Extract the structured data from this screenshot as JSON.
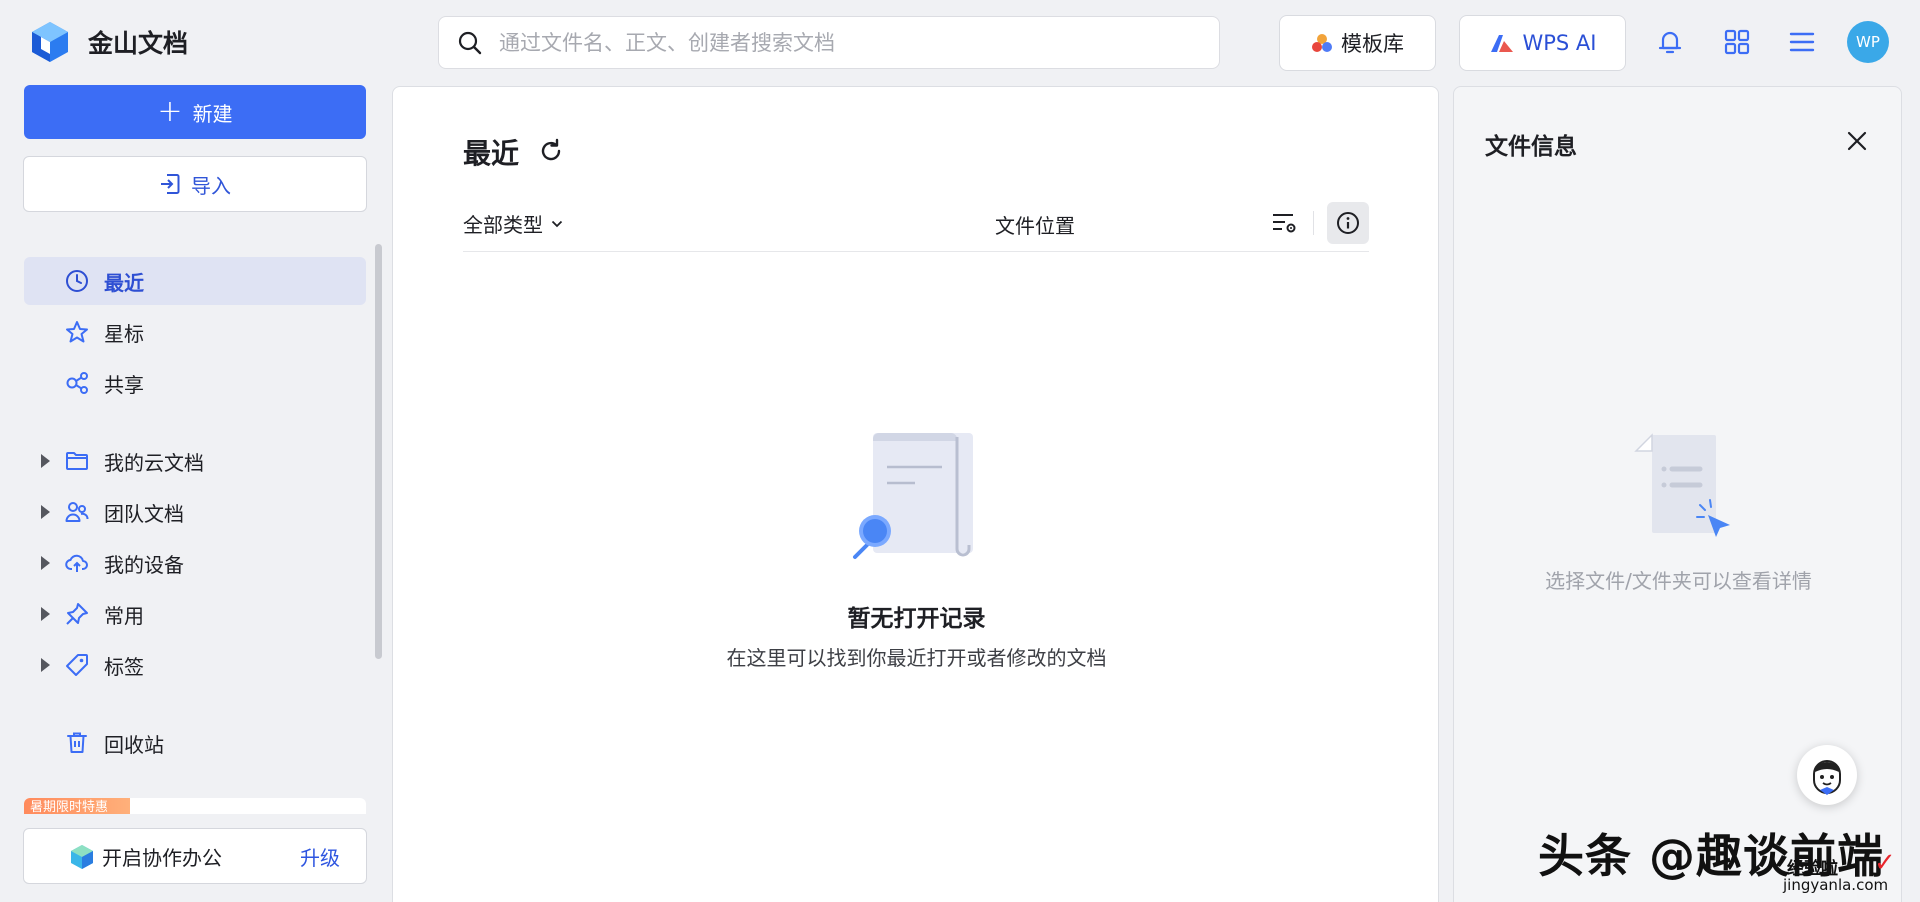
{
  "app": {
    "name": "金山文档"
  },
  "search": {
    "placeholder": "通过文件名、正文、创建者搜索文档"
  },
  "header": {
    "template_label": "模板库",
    "ai_label": "WPS AI",
    "avatar_text": "WP"
  },
  "sidebar": {
    "new_label": "新建",
    "import_label": "导入",
    "items": [
      {
        "label": "最近",
        "icon": "clock-icon",
        "active": true
      },
      {
        "label": "星标",
        "icon": "star-icon"
      },
      {
        "label": "共享",
        "icon": "share-icon"
      }
    ],
    "tree": [
      {
        "label": "我的云文档",
        "icon": "folder-icon"
      },
      {
        "label": "团队文档",
        "icon": "team-icon"
      },
      {
        "label": "我的设备",
        "icon": "cloud-upload-icon"
      },
      {
        "label": "常用",
        "icon": "pin-icon"
      },
      {
        "label": "标签",
        "icon": "tag-icon"
      }
    ],
    "trash_label": "回收站",
    "promo_badge": "暑期限时特惠",
    "collab_label": "开启协作办公",
    "upgrade_label": "升级"
  },
  "main": {
    "title": "最近",
    "filter_label": "全部类型",
    "location_header": "文件位置",
    "empty_title": "暂无打开记录",
    "empty_subtitle": "在这里可以找到你最近打开或者修改的文档"
  },
  "info_panel": {
    "title": "文件信息",
    "hint": "选择文件/文件夹可以查看详情"
  },
  "watermark": {
    "main": "头条 @趣谈前端",
    "small": "经验啦",
    "url": "jingyanla.com"
  },
  "colors": {
    "accent": "#3c6df5",
    "active_bg": "#dfe3f3",
    "active_text": "#2e4fd3"
  }
}
